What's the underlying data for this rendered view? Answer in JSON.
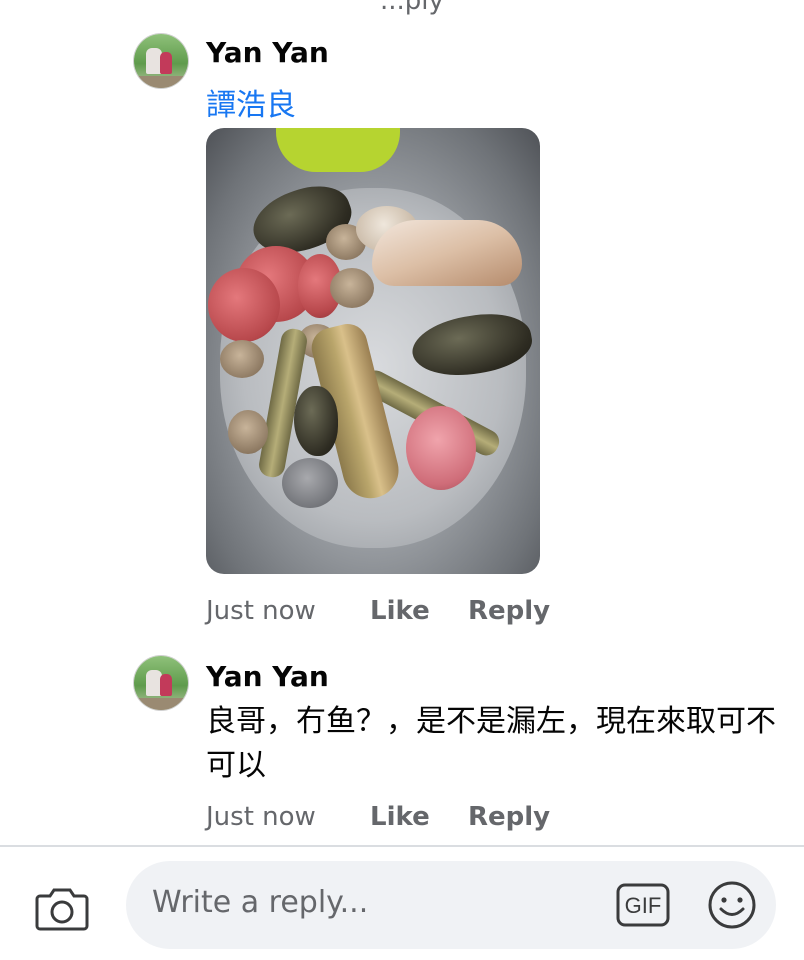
{
  "top_cut_text": "...ply",
  "comments": [
    {
      "author": "Yan Yan",
      "mention": "譚浩良",
      "photo_alt": "seafood in a steel basin",
      "time": "Just now",
      "like_label": "Like",
      "reply_label": "Reply"
    },
    {
      "author": "Yan Yan",
      "text": "良哥，冇鱼？，是不是漏左，現在來取可不可以",
      "time": "Just now",
      "like_label": "Like",
      "reply_label": "Reply"
    }
  ],
  "composer": {
    "placeholder": "Write a reply...",
    "gif_label": "GIF",
    "camera_icon": "camera-icon",
    "emoji_icon": "smiley-icon"
  },
  "colors": {
    "link": "#1877f2",
    "meta": "#65676b",
    "field_bg": "#f0f2f5"
  }
}
